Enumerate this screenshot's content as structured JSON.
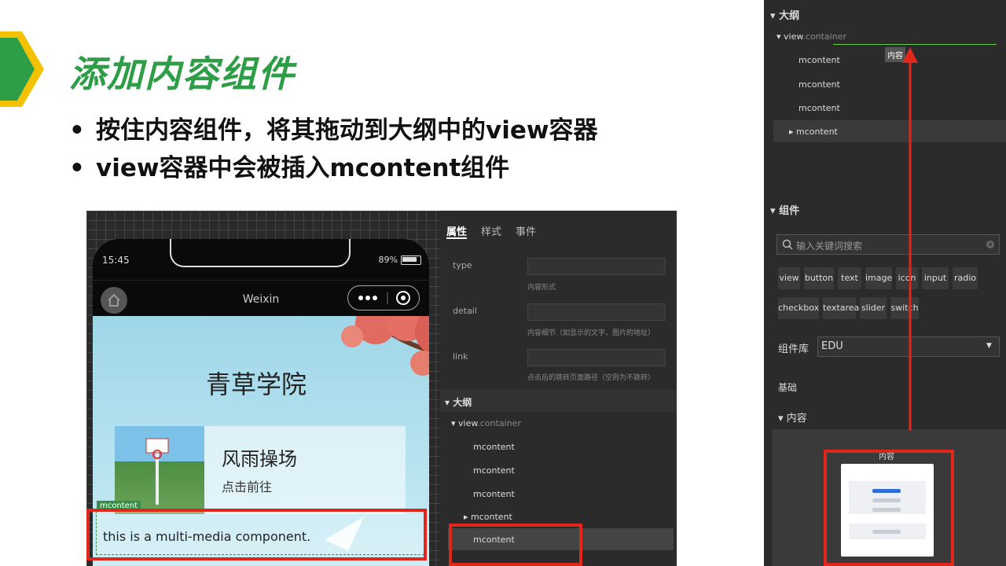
{
  "slide": {
    "title": "添加内容组件",
    "bullets": [
      "按住内容组件，将其拖动到大纲中的view容器",
      "view容器中会被插入mcontent组件"
    ],
    "accent_green": "#2e9e46",
    "highlight_red": "#e1261c"
  },
  "simulator": {
    "time": "15:45",
    "battery": "89%",
    "nav_title": "Weixin",
    "app_title": "青草学院",
    "card": {
      "title": "风雨操场",
      "subtitle": "点击前往"
    },
    "mm_tag": "mcontent",
    "mm_text": "this is a multi-media component."
  },
  "properties": {
    "tabs": [
      "属性",
      "样式",
      "事件"
    ],
    "fields": [
      {
        "label": "type",
        "hint": "内容形式"
      },
      {
        "label": "detail",
        "hint": "内容细节（如显示的文字、图片的地址）"
      },
      {
        "label": "link",
        "hint": "点击后的跳转页面路径（空则为不跳转）"
      }
    ]
  },
  "mid_outline": {
    "header": "大纲",
    "root": "view",
    "root_class": ".container",
    "items": [
      "mcontent",
      "mcontent",
      "mcontent",
      "mcontent",
      "mcontent"
    ]
  },
  "right_panel": {
    "outline_header": "大纲",
    "root": "view",
    "root_class": ".container",
    "items": [
      "mcontent",
      "mcontent",
      "mcontent",
      "mcontent"
    ],
    "drag_tip": "内容",
    "components_header": "组件",
    "search_placeholder": "输入关键词搜索",
    "chips_row1": [
      "view",
      "button",
      "text",
      "image",
      "icon",
      "input",
      "radio"
    ],
    "chips_row2": [
      "checkbox",
      "textarea",
      "slider",
      "switch"
    ],
    "library_label": "组件库",
    "library_value": "EDU",
    "basic_label": "基础",
    "content_label": "内容",
    "preview_label": "内容"
  }
}
